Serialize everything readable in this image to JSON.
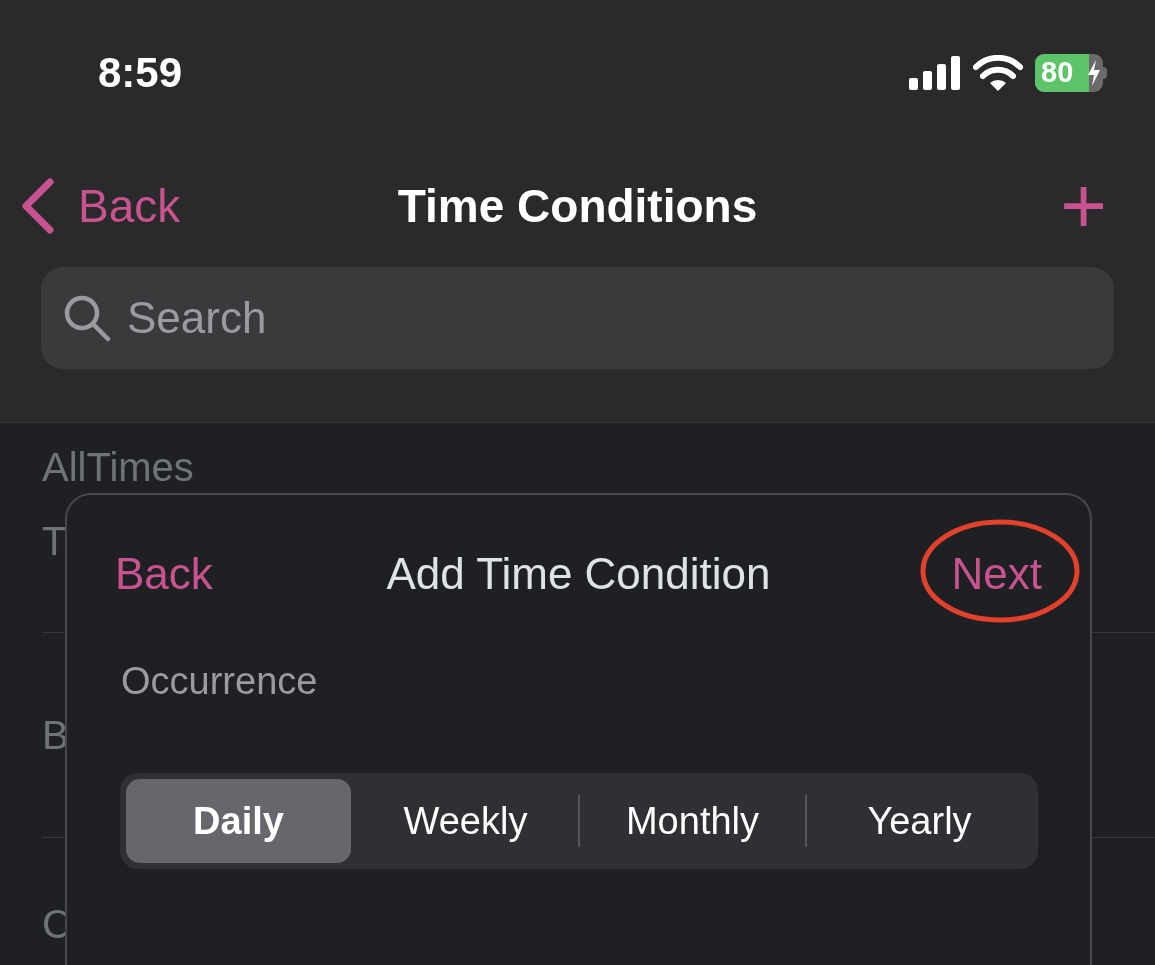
{
  "status_bar": {
    "time": "8:59",
    "battery": "80"
  },
  "nav": {
    "back": "Back",
    "title": "Time Conditions",
    "add": "+"
  },
  "search": {
    "placeholder": "Search"
  },
  "list": [
    {
      "title": "AllTimes",
      "subtitle": "T"
    },
    {
      "title": "B"
    },
    {
      "title": "C"
    }
  ],
  "modal": {
    "back": "Back",
    "title": "Add Time Condition",
    "next": "Next",
    "next_circled": true,
    "section": "Occurrence",
    "segments": [
      {
        "label": "Daily",
        "selected": true
      },
      {
        "label": "Weekly",
        "selected": false
      },
      {
        "label": "Monthly",
        "selected": false
      },
      {
        "label": "Yearly",
        "selected": false
      }
    ]
  }
}
